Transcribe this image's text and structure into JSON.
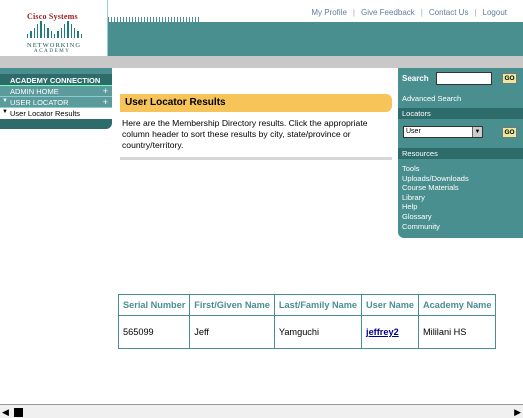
{
  "logo": {
    "brand": "Cisco Systems",
    "line1": "NETWORKING",
    "line2": "ACADEMY"
  },
  "top_links": [
    "My Profile",
    "Give Feedback",
    "Contact Us",
    "Logout"
  ],
  "nav": {
    "header": "ACADEMY CONNECTION",
    "items": [
      {
        "label": "ADMIN HOME",
        "expand": "+"
      },
      {
        "label": "USER LOCATOR",
        "expand": "+"
      }
    ],
    "current": "User Locator Results"
  },
  "main": {
    "title": "User Locator Results",
    "intro": "Here are the Membership Directory results. Click the appropriate column header to sort these results by city, state/province or country/territory."
  },
  "right": {
    "search_label": "Search",
    "search_value": "",
    "go_label": "GO",
    "advanced_search": "Advanced Search",
    "locators_header": "Locators",
    "locator_selected": "User",
    "resources_header": "Resources",
    "resources": [
      "Tools",
      "Uploads/Downloads",
      "Course Materials",
      "Library",
      "Help",
      "Glossary",
      "Community"
    ]
  },
  "table": {
    "headers": [
      "Serial Number",
      "First/Given Name",
      "Last/Family Name",
      "User Name",
      "Academy Name"
    ],
    "rows": [
      [
        "565099",
        "Jeff",
        "Yamguchi",
        "jeffrey2",
        "Mililani HS"
      ]
    ]
  },
  "colors": {
    "teal": "#4a8f8f",
    "dark_teal": "#2e6b6b",
    "title_bar": "#f7c45a"
  }
}
